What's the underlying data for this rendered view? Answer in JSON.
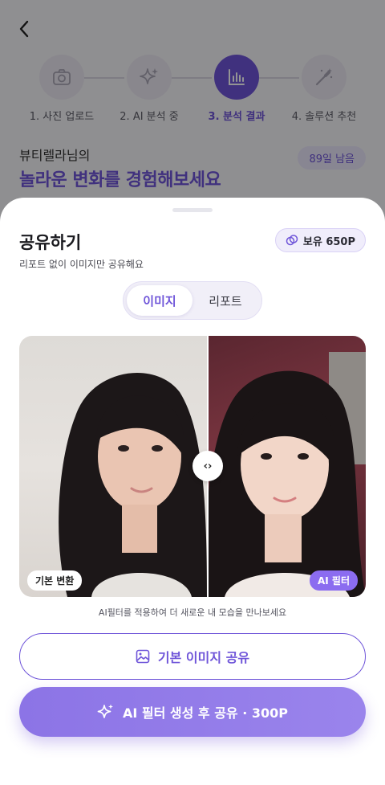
{
  "steps": [
    {
      "label": "1. 사진 업로드",
      "icon": "camera-icon",
      "active": false
    },
    {
      "label": "2. AI 분석 중",
      "icon": "sparkles-icon",
      "active": false
    },
    {
      "label": "3. 분석 결과",
      "icon": "bar-chart-icon",
      "active": true
    },
    {
      "label": "4. 솔루션 추천",
      "icon": "magic-wand-icon",
      "active": false
    }
  ],
  "background": {
    "subtitle": "뷰티렐라님의",
    "title": "놀라운 변화를 경험해보세요",
    "days_badge": "89일 남음"
  },
  "sheet": {
    "title": "공유하기",
    "description": "리포트 없이 이미지만 공유해요",
    "points_badge": "보유 650P",
    "tabs": [
      {
        "label": "이미지",
        "selected": true
      },
      {
        "label": "리포트",
        "selected": false
      }
    ],
    "compare": {
      "left_tag": "기본 변환",
      "right_tag": "AI 필터",
      "handle": "‹›"
    },
    "hint": "AI필터를 적용하여 더 새로운 내 모습을 만나보세요",
    "basic_share_label": "기본 이미지 공유",
    "ai_share_label": "AI 필터 생성 후 공유 · 300P"
  },
  "colors": {
    "accent": "#6f55d9",
    "accent_light": "#9a84ec"
  }
}
